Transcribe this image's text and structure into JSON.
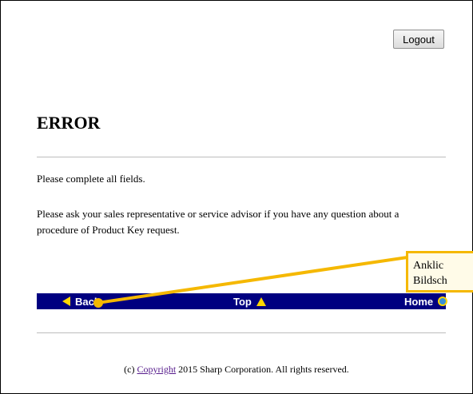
{
  "header": {
    "logout_label": "Logout"
  },
  "main": {
    "title": "ERROR",
    "message1": "Please complete all fields.",
    "message2": "Please ask your sales representative or service advisor if you have any question about a procedure of Product Key request."
  },
  "nav": {
    "back_label": "Back",
    "top_label": "Top",
    "home_label": "Home"
  },
  "footer": {
    "prefix": "(c)",
    "link": "Copyright",
    "suffix": "2015 Sharp Corporation. All rights reserved."
  },
  "callout": {
    "line1": "Anklic",
    "line2": "Bildsch"
  },
  "colors": {
    "navbar": "#000080",
    "accent": "#ffd700",
    "callout": "#f5b800"
  }
}
